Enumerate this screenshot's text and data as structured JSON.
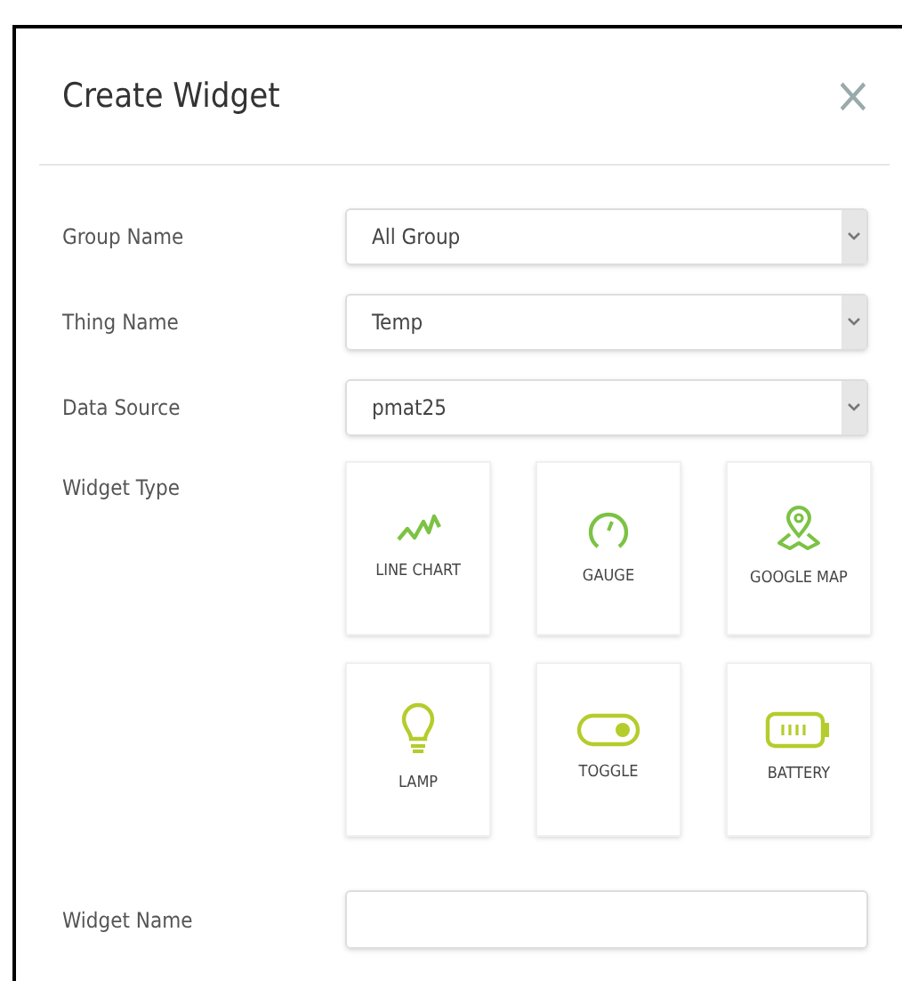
{
  "dialog": {
    "title": "Create Widget",
    "close": "×"
  },
  "fields": [
    {
      "label": "Group Name",
      "kind": "select",
      "value": "All Group"
    },
    {
      "label": "Thing Name",
      "kind": "select",
      "value": "Temp"
    },
    {
      "label": "Data Source",
      "kind": "select",
      "value": "pmat25"
    }
  ],
  "widget_type": {
    "label": "Widget Type",
    "options": [
      {
        "kind": "line",
        "label": "LINE CHART"
      },
      {
        "kind": "gauge",
        "label": "GAUGE"
      },
      {
        "kind": "map",
        "label": "GOOGLE MAP"
      },
      {
        "kind": "lamp",
        "label": "LAMP"
      },
      {
        "kind": "toggle",
        "label": "TOGGLE"
      },
      {
        "kind": "battery",
        "label": "BATTERY"
      }
    ]
  },
  "widget_name": {
    "label": "Widget Name",
    "kind": "text"
  }
}
